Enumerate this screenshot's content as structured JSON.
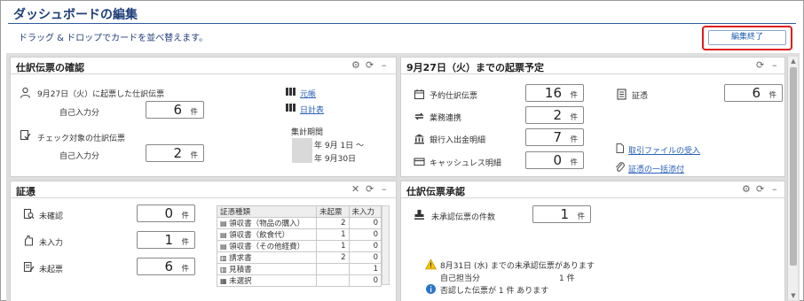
{
  "header": {
    "title": "ダッシュボードの編集",
    "subtitle": "ドラッグ & ドロップでカードを並べ替えます。",
    "finish_button": "編集終了"
  },
  "colors": {
    "accent": "#1f3f7a",
    "highlight": "#e01b1b",
    "link": "#2a62b8"
  },
  "journal": {
    "title": "仕訳伝票の確認",
    "row1_label": "9月27日（火）に起票した仕訳伝票",
    "row1_sub": "自己入力分",
    "row1_value": "6",
    "row2_label": "チェック対象の仕訳伝票",
    "row2_sub": "自己入力分",
    "row2_value": "2",
    "unit": "件",
    "link_ledger": "元帳",
    "link_daily": "日計表",
    "period_label": "集計期間",
    "period_from": "年  9月 1日 ～",
    "period_to": "年  9月30日"
  },
  "schedule": {
    "title": "9月27日（火）までの起票予定",
    "items": [
      {
        "label": "予約仕訳伝票",
        "value": "16",
        "icon": "calendar-icon"
      },
      {
        "label": "業務連携",
        "value": "2",
        "icon": "sync-icon"
      },
      {
        "label": "銀行入出金明細",
        "value": "7",
        "icon": "bank-icon"
      },
      {
        "label": "キャッシュレス明細",
        "value": "0",
        "icon": "card-icon"
      }
    ],
    "voucher_label": "証憑",
    "voucher_value": "6",
    "unit": "件",
    "link_import": "取引ファイルの受入",
    "link_attach": "証憑の一括添付"
  },
  "vouchers": {
    "title": "証憑",
    "items": [
      {
        "label": "未確認",
        "value": "0"
      },
      {
        "label": "未入力",
        "value": "1"
      },
      {
        "label": "未起票",
        "value": "6"
      }
    ],
    "unit": "件",
    "table_headers": [
      "証憑種類",
      "未起票",
      "未入力"
    ],
    "table_rows": [
      {
        "name": "領収書（物品の購入）",
        "unposted": "2",
        "unentered": "0"
      },
      {
        "name": "領収書（飲食代）",
        "unposted": "1",
        "unentered": "0"
      },
      {
        "name": "領収書（その他経費）",
        "unposted": "1",
        "unentered": "0"
      },
      {
        "name": "請求書",
        "unposted": "2",
        "unentered": "0"
      },
      {
        "name": "見積書",
        "unposted": "",
        "unentered": "1"
      },
      {
        "name": "未選択",
        "unposted": "",
        "unentered": "0"
      }
    ]
  },
  "approval": {
    "title": "仕訳伝票承認",
    "label": "未承認伝票の件数",
    "value": "1",
    "unit": "件",
    "warning": "8月31日 (水) までの未承認伝票があります",
    "self_label": "自己担当分",
    "self_value": "1 件",
    "info": "否認した伝票が 1 件 あります"
  }
}
